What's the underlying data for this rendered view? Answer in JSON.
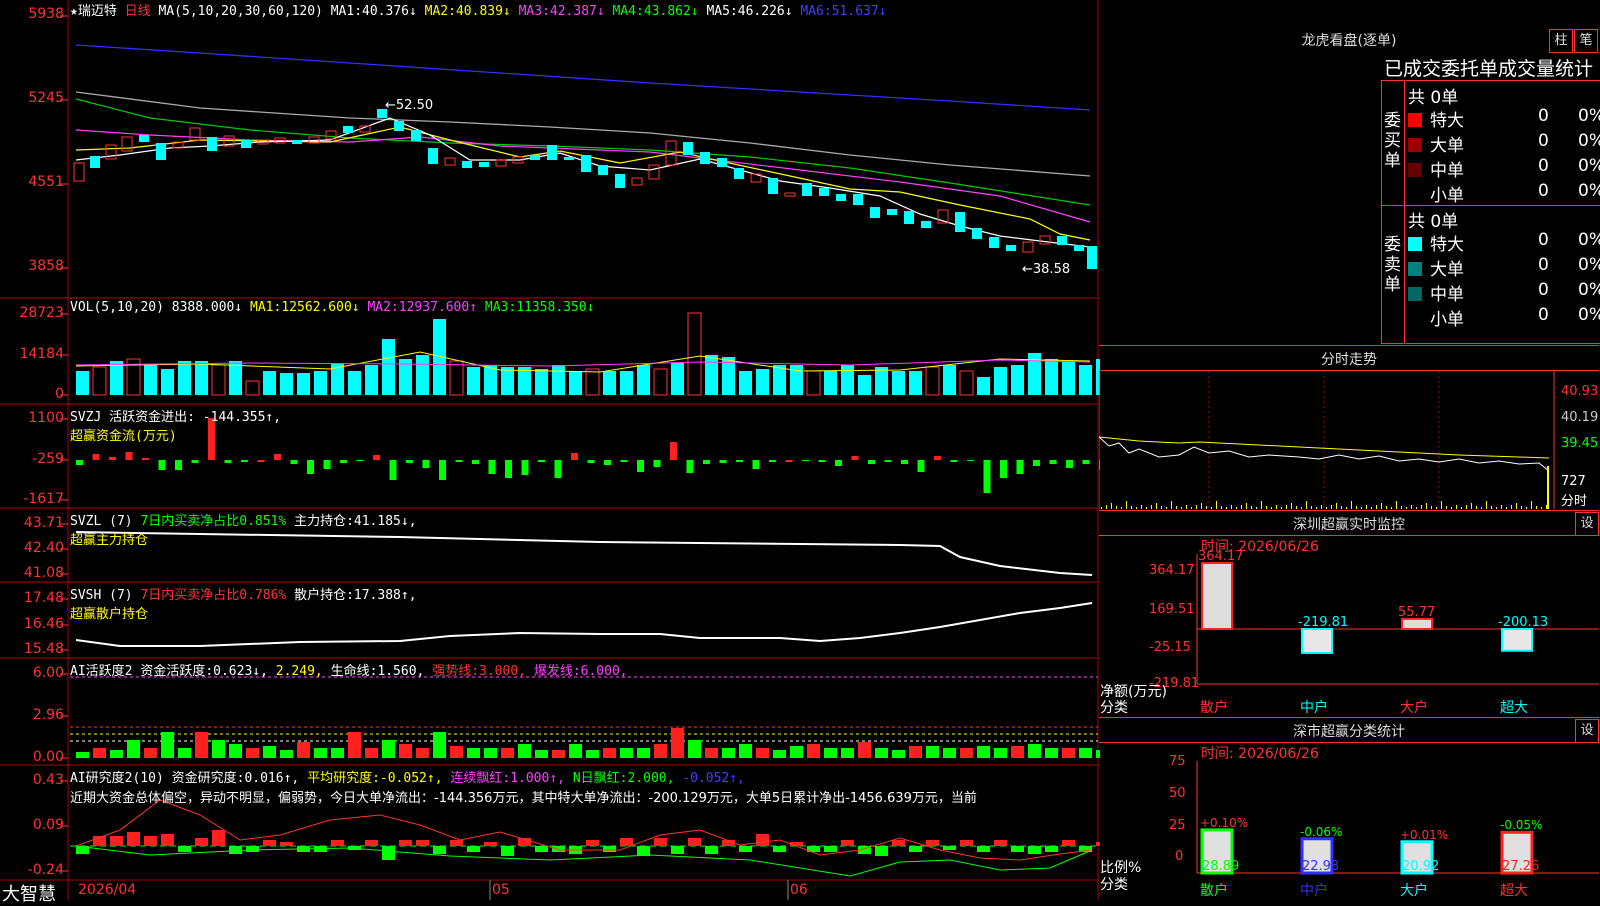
{
  "stock": {
    "star": "★",
    "name": "瑞迈特",
    "period": "日线"
  },
  "kline": {
    "ma_label": "MA(5,10,20,30,60,120)",
    "ma": [
      {
        "k": "MA1:",
        "v": "40.376↓",
        "color": "#ffffff"
      },
      {
        "k": "MA2:",
        "v": "40.839↓",
        "color": "#ffff00"
      },
      {
        "k": "MA3:",
        "v": "42.387↓",
        "color": "#ff40ff"
      },
      {
        "k": "MA4:",
        "v": "43.862↓",
        "color": "#00ff00"
      },
      {
        "k": "MA5:",
        "v": "46.226↓",
        "color": "#dddddd"
      },
      {
        "k": "MA6:",
        "v": "51.637↓",
        "color": "#4040ff"
      }
    ],
    "yticks": [
      "5938",
      "5245",
      "4551",
      "3858"
    ],
    "high_note": "←52.50",
    "low_note": "←38.58"
  },
  "volume": {
    "label": "VOL(5,10,20)",
    "value": "8388.000↓",
    "ma": [
      {
        "k": "MA1:",
        "v": "12562.600↓",
        "color": "#ffff00"
      },
      {
        "k": "MA2:",
        "v": "12937.600↑",
        "color": "#ff40ff"
      },
      {
        "k": "MA3:",
        "v": "11358.350↓",
        "color": "#00ff00"
      }
    ],
    "yticks": [
      "28723",
      "14184",
      "0"
    ]
  },
  "svzj": {
    "label": "SVZJ",
    "title": "活跃资金进出:",
    "value": "-144.355↑,",
    "sub": "超赢资金流(万元)",
    "yticks": [
      "1100",
      "-259",
      "-1617"
    ]
  },
  "svzl": {
    "label": "SVZL (7)",
    "t1": "7日内买卖净占比0.851%",
    "t2": "主力持仓:",
    "v2": "41.185↓,",
    "sub": "超赢主力持仓",
    "yticks": [
      "43.71",
      "42.40",
      "41.08"
    ]
  },
  "svsh": {
    "label": "SVSH (7)",
    "t1": "7日内买卖净占比0.786%",
    "t2": "散户持仓:",
    "v2": "17.388↑,",
    "sub": "超赢散户持仓",
    "yticks": [
      "17.48",
      "16.46",
      "15.48"
    ]
  },
  "ai1": {
    "label": "AI活跃度2",
    "t1": "资金活跃度:",
    "v1": "0.623↓,",
    "v2": "2.249,",
    "t3": "生命线:",
    "v3": "1.560,",
    "t4": "强势线:",
    "v4": "3.000,",
    "t5": "爆发线:",
    "v5": "6.000,",
    "yticks": [
      "6.00",
      "2.96",
      "0.00"
    ]
  },
  "ai2": {
    "label": "AI研究度2(10)",
    "t1": "资金研究度:",
    "v1": "0.016↑,",
    "t2": "平均研究度:",
    "v2": "-0.052↑,",
    "t3": "连续飘红:",
    "v3": "1.000↑,",
    "t4": "N日飘红:",
    "v4": "2.000,",
    "v5": "-0.052↑,",
    "comment": "近期大资金总体偏空，异动不明显，偏弱势，今日大单净流出：-144.356万元，其中特大单净流出：-200.129万元，大单5日累计净出-1456.639万元，当前",
    "yticks": [
      "0.43",
      "0.09",
      "-0.24"
    ]
  },
  "xaxis": {
    "logo": "大智慧",
    "dates": [
      "2026/04",
      "05",
      "06"
    ]
  },
  "lhb": {
    "title": "龙虎看盘(逐单)",
    "btn1": "柱",
    "btn2": "笔",
    "subtitle": "已成交委托单成交量统计",
    "buy_side": "委买单",
    "sell_side": "委卖单",
    "buy_total": "共 0单",
    "sell_total": "共 0单",
    "buy_rows": [
      {
        "name": "特大",
        "count": "0",
        "pct": "0%",
        "color": "#ff0000"
      },
      {
        "name": "大单",
        "count": "0",
        "pct": "0%",
        "color": "#990000"
      },
      {
        "name": "中单",
        "count": "0",
        "pct": "0%",
        "color": "#660000"
      },
      {
        "name": "小单",
        "count": "0",
        "pct": "0%",
        "color": "#000000"
      }
    ],
    "sell_rows": [
      {
        "name": "特大",
        "count": "0",
        "pct": "0%",
        "color": "#00ffff"
      },
      {
        "name": "大单",
        "count": "0",
        "pct": "0%",
        "color": "#008080"
      },
      {
        "name": "中单",
        "count": "0",
        "pct": "0%",
        "color": "#006666"
      },
      {
        "name": "小单",
        "count": "0",
        "pct": "0%",
        "color": "#000000"
      }
    ]
  },
  "intraday": {
    "title": "分时走势",
    "yticks": [
      "40.93",
      "40.19",
      "39.45"
    ],
    "vol": "727",
    "vol_unit": "分时"
  },
  "monitor": {
    "title": "深圳超赢实时监控",
    "btn": "设",
    "time": "时间: 2026/06/26",
    "yticks": [
      "364.17",
      "169.51",
      "-25.15",
      "-219.81"
    ],
    "ylabel1": "净额(万元)",
    "ylabel2": "分类",
    "bars": [
      {
        "cat": "散户",
        "value": "364.17"
      },
      {
        "cat": "中户",
        "value": "-219.81"
      },
      {
        "cat": "大户",
        "value": "55.77"
      },
      {
        "cat": "超大",
        "value": "-200.13"
      }
    ]
  },
  "classify": {
    "title": "深市超赢分类统计",
    "btn": "设",
    "time": "时间: 2026/06/26",
    "yticks": [
      "75",
      "50",
      "25",
      "0"
    ],
    "ylabel1": "比例%",
    "ylabel2": "分类",
    "bars": [
      {
        "cat": "散户",
        "pct": "+0.10%",
        "value": "28.89",
        "color": "#00ff00"
      },
      {
        "cat": "中户",
        "pct": "-0.06%",
        "value": "22.93",
        "color": "#3030ff"
      },
      {
        "cat": "大户",
        "pct": "+0.01%",
        "value": "20.92",
        "color": "#00ffff"
      },
      {
        "cat": "超大",
        "pct": "-0.05%",
        "value": "27.26",
        "color": "#ff2020"
      }
    ]
  }
}
